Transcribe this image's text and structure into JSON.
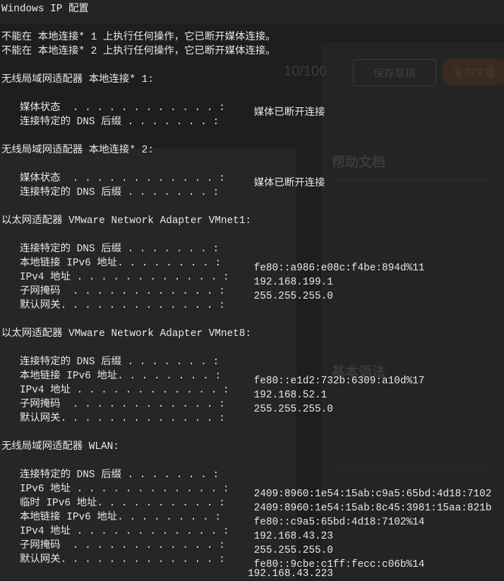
{
  "window_title": "Windows IP 配置",
  "disconnected_messages": [
    "不能在 本地连接* 1 上执行任何操作，它已断开媒体连接。",
    "不能在 本地连接* 2 上执行任何操作，它已断开媒体连接。"
  ],
  "adapters": [
    {
      "heading": "无线局域网适配器 本地连接* 1:",
      "fields": [
        {
          "label": "媒体状态  . . . . . . . . . . . . :",
          "value": " 媒体已断开连接"
        },
        {
          "label": "连接特定的 DNS 后缀 . . . . . . . :",
          "value": ""
        }
      ]
    },
    {
      "heading": "无线局域网适配器 本地连接* 2:",
      "fields": [
        {
          "label": "媒体状态  . . . . . . . . . . . . :",
          "value": " 媒体已断开连接"
        },
        {
          "label": "连接特定的 DNS 后缀 . . . . . . . :",
          "value": ""
        }
      ]
    },
    {
      "heading": "以太网适配器 VMware Network Adapter VMnet1:",
      "fields": [
        {
          "label": "连接特定的 DNS 后缀 . . . . . . . :",
          "value": ""
        },
        {
          "label": "本地链接 IPv6 地址. . . . . . . . :",
          "value": " fe80::a986:e08c:f4be:894d%11"
        },
        {
          "label": "IPv4 地址 . . . . . . . . . . . . :",
          "value": " 192.168.199.1"
        },
        {
          "label": "子网掩码  . . . . . . . . . . . . :",
          "value": " 255.255.255.0"
        },
        {
          "label": "默认网关. . . . . . . . . . . . . :",
          "value": ""
        }
      ]
    },
    {
      "heading": "以太网适配器 VMware Network Adapter VMnet8:",
      "fields": [
        {
          "label": "连接特定的 DNS 后缀 . . . . . . . :",
          "value": ""
        },
        {
          "label": "本地链接 IPv6 地址. . . . . . . . :",
          "value": " fe80::e1d2:732b:6309:a10d%17"
        },
        {
          "label": "IPv4 地址 . . . . . . . . . . . . :",
          "value": " 192.168.52.1"
        },
        {
          "label": "子网掩码  . . . . . . . . . . . . :",
          "value": " 255.255.255.0"
        },
        {
          "label": "默认网关. . . . . . . . . . . . . :",
          "value": ""
        }
      ]
    },
    {
      "heading": "无线局域网适配器 WLAN:",
      "fields": [
        {
          "label": "连接特定的 DNS 后缀 . . . . . . . :",
          "value": ""
        },
        {
          "label": "IPv6 地址 . . . . . . . . . . . . :",
          "value": " 2409:8960:1e54:15ab:c9a5:65bd:4d18:7102"
        },
        {
          "label": "临时 IPv6 地址. . . . . . . . . . :",
          "value": " 2409:8960:1e54:15ab:8c45:3981:15aa:821b"
        },
        {
          "label": "本地链接 IPv6 地址. . . . . . . . :",
          "value": " fe80::c9a5:65bd:4d18:7102%14"
        },
        {
          "label": "IPv4 地址 . . . . . . . . . . . . :",
          "value": " 192.168.43.23"
        },
        {
          "label": "子网掩码  . . . . . . . . . . . . :",
          "value": " 255.255.255.0"
        },
        {
          "label": "默认网关. . . . . . . . . . . . . :",
          "value": " fe80::9cbe:c1ff:fecc:c06b%14"
        }
      ],
      "gateway_continuation": "192.168.43.223"
    }
  ],
  "background_ui": {
    "counter": "10/100",
    "save_draft_button": "保存草稿",
    "publish_button": "发布文章",
    "help_heading": "帮助文档",
    "section_heading": "基本语法"
  },
  "colors": {
    "terminal_bg": "#1e1e1e",
    "terminal_fg": "#e8e8e8"
  }
}
